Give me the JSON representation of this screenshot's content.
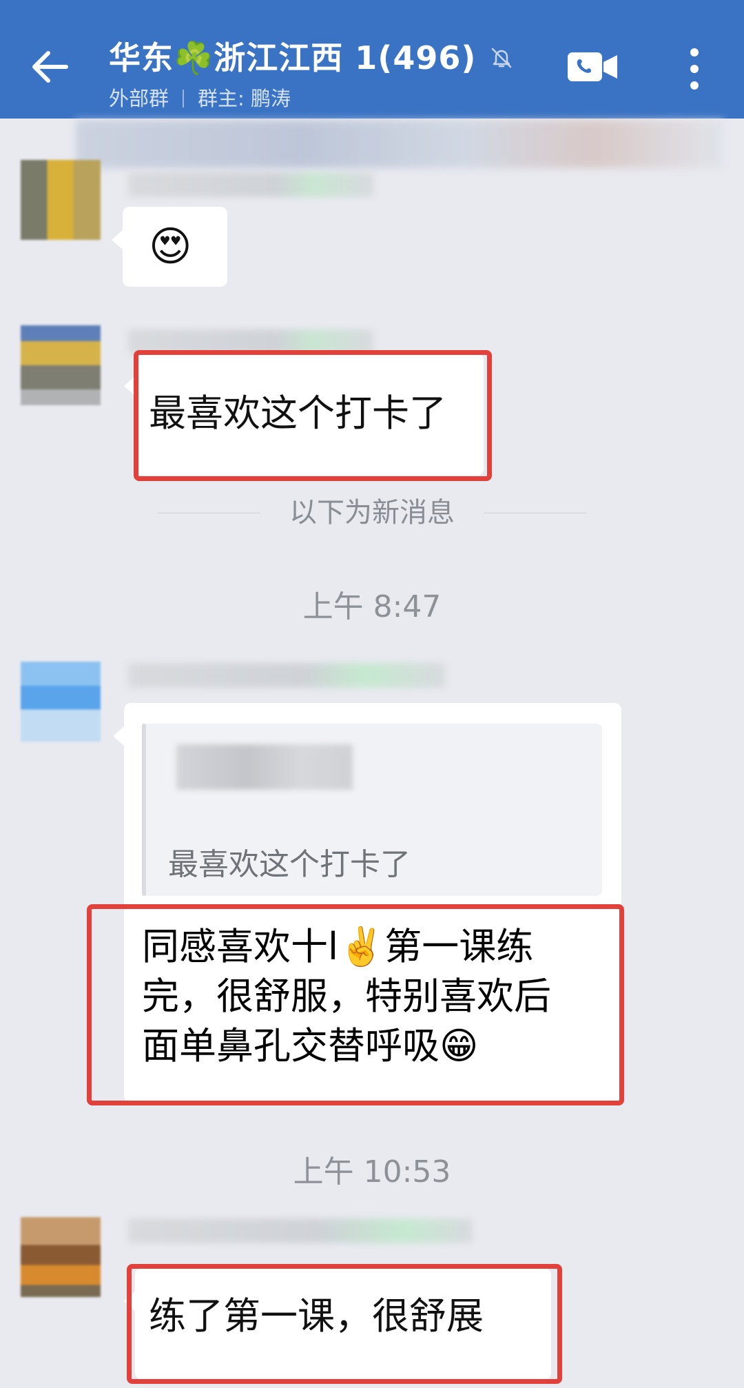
{
  "header": {
    "title": "华东☘️浙江江西 1(496)",
    "tag": "外部群",
    "owner": "群主: 鹏涛",
    "bg_color": "#3a73c4"
  },
  "icons": {
    "back": "back-arrow-icon",
    "mute": "bell-off-icon",
    "video": "video-call-icon",
    "more": "more-vertical-icon"
  },
  "messages": [
    {
      "type": "emoji",
      "text": "😍"
    },
    {
      "type": "text",
      "text": "最喜欢这个打卡了",
      "highlighted": true
    },
    {
      "type": "divider",
      "text": "以下为新消息"
    },
    {
      "type": "time",
      "text": "上午 8:47"
    },
    {
      "type": "reply",
      "quote": "最喜欢这个打卡了",
      "lines": [
        "同感喜欢十l✌️第一课练",
        "完，很舒服，特别喜欢后",
        "面单鼻孔交替呼吸😁"
      ],
      "highlighted": true
    },
    {
      "type": "time",
      "text": "上午 10:53"
    },
    {
      "type": "text",
      "text": "练了第一课，很舒展",
      "highlighted": true
    }
  ],
  "colors": {
    "highlight": "#e2403b",
    "chat_bg": "#e9eaf0",
    "bubble": "#ffffff"
  }
}
